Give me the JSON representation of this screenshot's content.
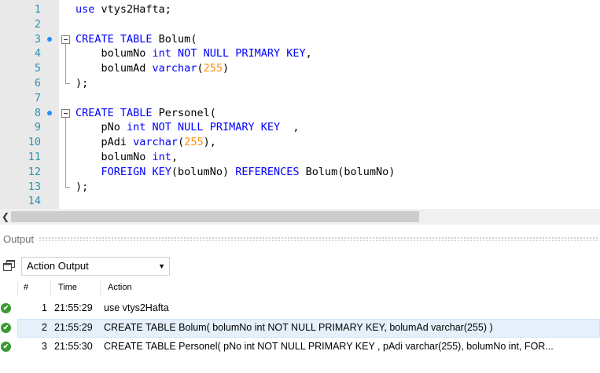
{
  "editor": {
    "lines": [
      {
        "n": "1",
        "tokens": [
          {
            "t": "use",
            "c": "kw"
          },
          {
            "t": " vtys2Hafta;",
            "c": "id"
          }
        ]
      },
      {
        "n": "2",
        "tokens": []
      },
      {
        "n": "3",
        "bp": true,
        "fold": "start",
        "tokens": [
          {
            "t": "CREATE TABLE",
            "c": "kw"
          },
          {
            "t": " Bolum(",
            "c": "id"
          }
        ]
      },
      {
        "n": "4",
        "fold": "mid",
        "tokens": [
          {
            "t": "    bolumNo ",
            "c": "id"
          },
          {
            "t": "int NOT NULL PRIMARY KEY",
            "c": "kw"
          },
          {
            "t": ",",
            "c": "id"
          }
        ]
      },
      {
        "n": "5",
        "fold": "mid",
        "tokens": [
          {
            "t": "    bolumAd ",
            "c": "id"
          },
          {
            "t": "varchar",
            "c": "kw"
          },
          {
            "t": "(",
            "c": "id"
          },
          {
            "t": "255",
            "c": "str"
          },
          {
            "t": ")",
            "c": "id"
          }
        ]
      },
      {
        "n": "6",
        "fold": "end",
        "tokens": [
          {
            "t": ");",
            "c": "id"
          }
        ]
      },
      {
        "n": "7",
        "tokens": []
      },
      {
        "n": "8",
        "bp": true,
        "fold": "start",
        "tokens": [
          {
            "t": "CREATE TABLE",
            "c": "kw"
          },
          {
            "t": " Personel(",
            "c": "id"
          }
        ]
      },
      {
        "n": "9",
        "fold": "mid",
        "tokens": [
          {
            "t": "    pNo ",
            "c": "id"
          },
          {
            "t": "int NOT NULL PRIMARY KEY",
            "c": "kw"
          },
          {
            "t": "  ,",
            "c": "id"
          }
        ]
      },
      {
        "n": "10",
        "fold": "mid",
        "tokens": [
          {
            "t": "    pAdi ",
            "c": "id"
          },
          {
            "t": "varchar",
            "c": "kw"
          },
          {
            "t": "(",
            "c": "id"
          },
          {
            "t": "255",
            "c": "str"
          },
          {
            "t": "),",
            "c": "id"
          }
        ]
      },
      {
        "n": "11",
        "fold": "mid",
        "tokens": [
          {
            "t": "    bolumNo ",
            "c": "id"
          },
          {
            "t": "int",
            "c": "kw"
          },
          {
            "t": ",",
            "c": "id"
          }
        ]
      },
      {
        "n": "12",
        "fold": "mid",
        "tokens": [
          {
            "t": "    ",
            "c": "id"
          },
          {
            "t": "FOREIGN KEY",
            "c": "kw"
          },
          {
            "t": "(bolumNo) ",
            "c": "id"
          },
          {
            "t": "REFERENCES",
            "c": "kw"
          },
          {
            "t": " Bolum(bolumNo)",
            "c": "id"
          }
        ]
      },
      {
        "n": "13",
        "fold": "end",
        "tokens": [
          {
            "t": ");",
            "c": "id"
          }
        ]
      },
      {
        "n": "14",
        "tokens": []
      }
    ]
  },
  "output": {
    "title": "Output",
    "selected_source": "Action Output",
    "columns": [
      "#",
      "Time",
      "Action"
    ],
    "rows": [
      {
        "num": "1",
        "time": "21:55:29",
        "action": "use vtys2Hafta",
        "status": "ok"
      },
      {
        "num": "2",
        "time": "21:55:29",
        "action": "CREATE TABLE Bolum( bolumNo int NOT NULL PRIMARY KEY, bolumAd varchar(255) )",
        "status": "ok",
        "selected": true
      },
      {
        "num": "3",
        "time": "21:55:30",
        "action": "CREATE TABLE Personel( pNo int NOT NULL PRIMARY KEY  , pAdi varchar(255), bolumNo int, FOR...",
        "status": "ok"
      }
    ]
  },
  "colors": {
    "keyword": "#0000ff",
    "number": "#ff8c00",
    "line_number": "#2b91af",
    "success": "#3a9a30",
    "selection": "#e5f0fb"
  }
}
